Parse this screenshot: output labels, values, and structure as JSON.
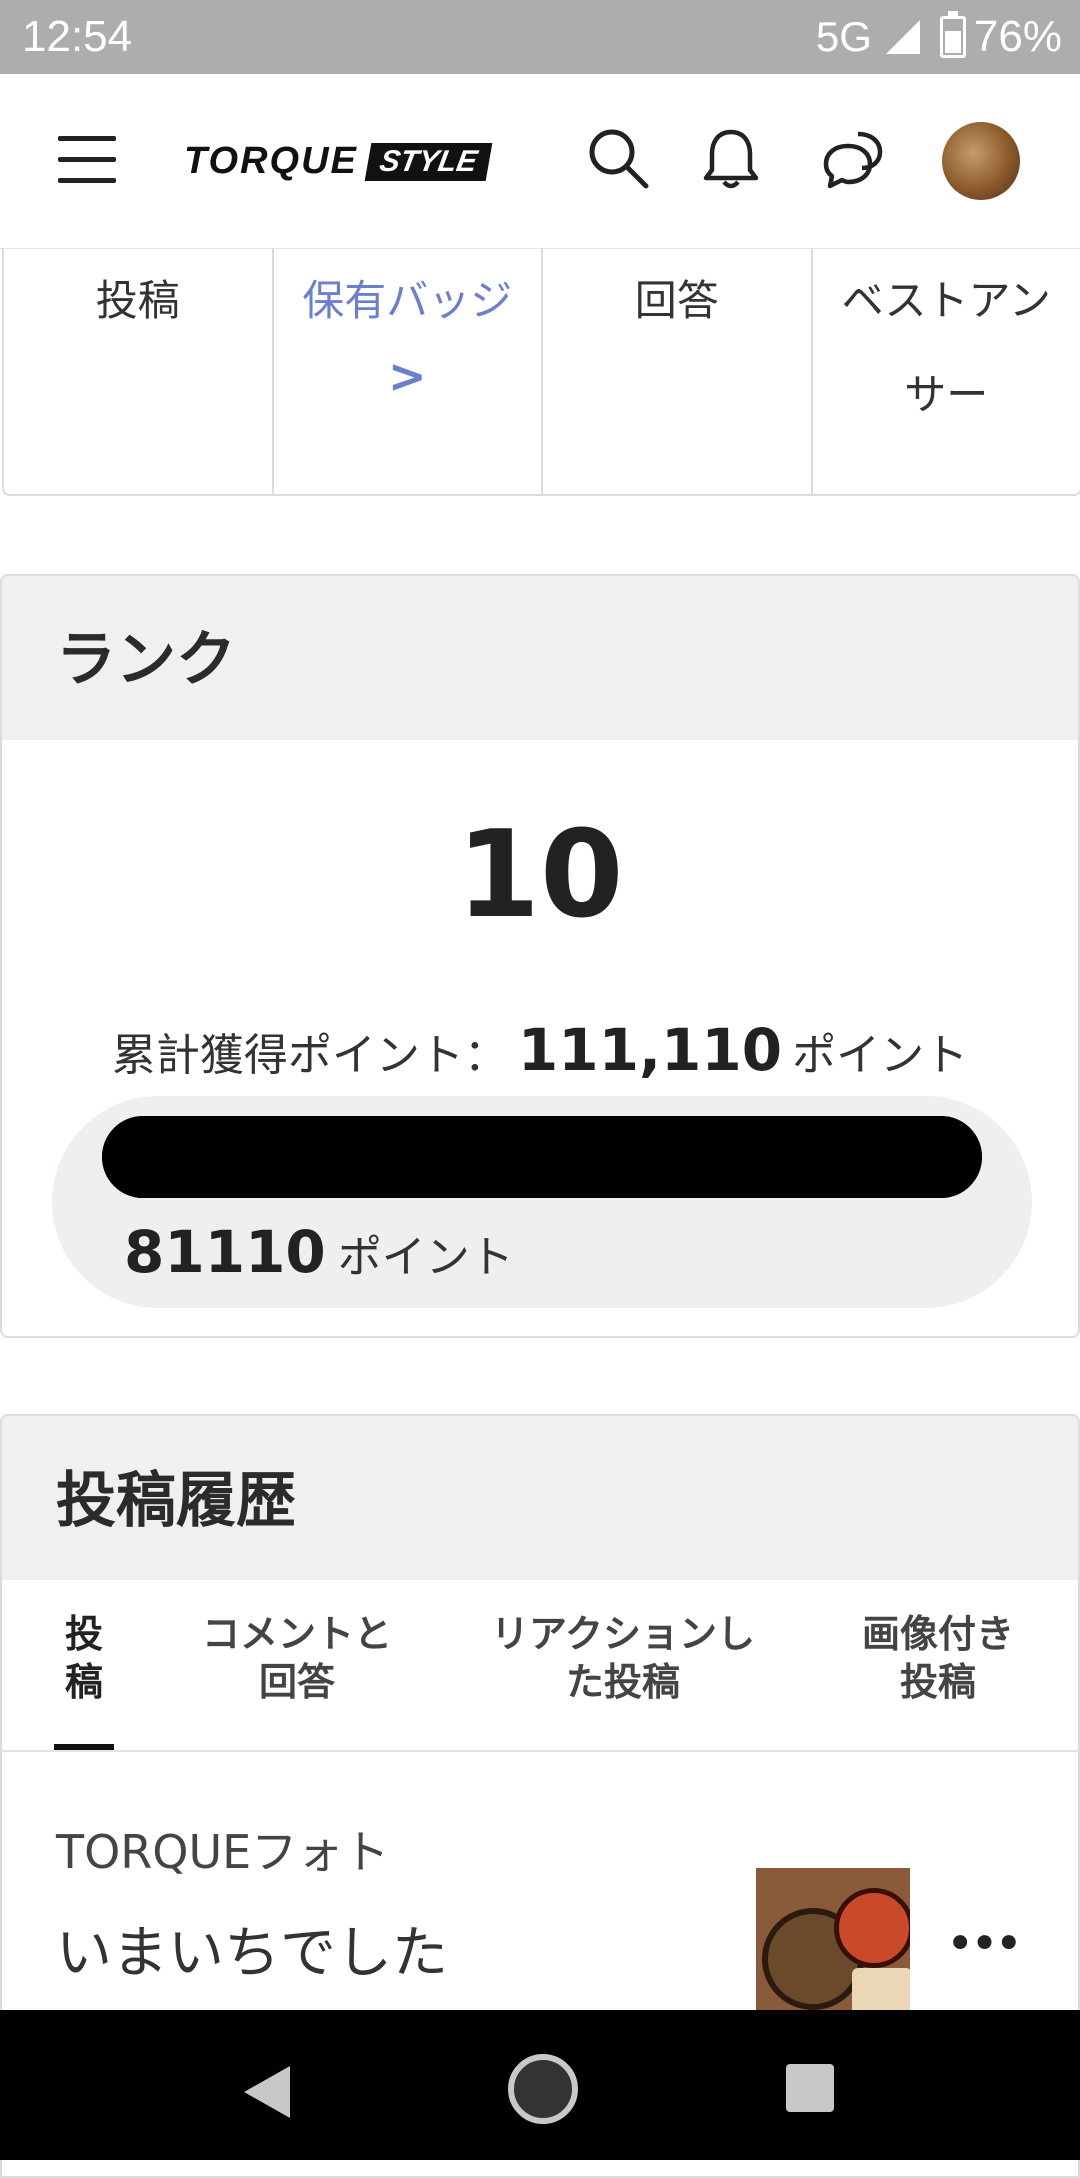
{
  "status_bar": {
    "time": "12:54",
    "network": "5G",
    "battery": "76%"
  },
  "header": {
    "logo_torque": "TORQUE",
    "logo_style": "STYLE",
    "icons": [
      "menu-icon",
      "search-icon",
      "bell-icon",
      "chat-icon",
      "avatar"
    ]
  },
  "stats_tabs": [
    {
      "label": "投稿"
    },
    {
      "label": "保有バッジ",
      "chevron": ">"
    },
    {
      "label": "回答"
    },
    {
      "label": "ベストアン",
      "label2": "サー"
    }
  ],
  "rank": {
    "title": "ランク",
    "value": "10",
    "total_label": "累計獲得ポイント：",
    "total_value": "111,110",
    "total_unit": "ポイント",
    "progress_value": "81110",
    "progress_unit": "ポイント",
    "progress_fraction": 1.0
  },
  "history": {
    "title": "投稿履歴",
    "tabs": [
      {
        "line1": "投",
        "line2": "稿"
      },
      {
        "line1": "コメントと",
        "line2": "回答"
      },
      {
        "line1": "リアクションし",
        "line2": "た投稿"
      },
      {
        "line1": "画像付き",
        "line2": "投稿"
      }
    ],
    "post": {
      "category": "TORQUEフォト",
      "title": "いまいちでした",
      "more": "•••"
    }
  },
  "colors": {
    "accent": "#6b7fd1",
    "status_bar": "#adadad",
    "card_header": "#f1f0ef"
  }
}
